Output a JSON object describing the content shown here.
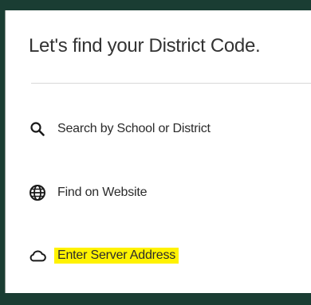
{
  "page": {
    "title": "Let's find your District Code."
  },
  "options": [
    {
      "label": "Search by School or District",
      "icon": "search-icon"
    },
    {
      "label": "Find on Website",
      "icon": "globe-icon"
    },
    {
      "label": "Enter Server Address",
      "icon": "cloud-icon",
      "highlighted": true
    }
  ],
  "colors": {
    "frame": "#1a3d33",
    "highlight": "#fff200",
    "text": "#2b2b2b"
  }
}
